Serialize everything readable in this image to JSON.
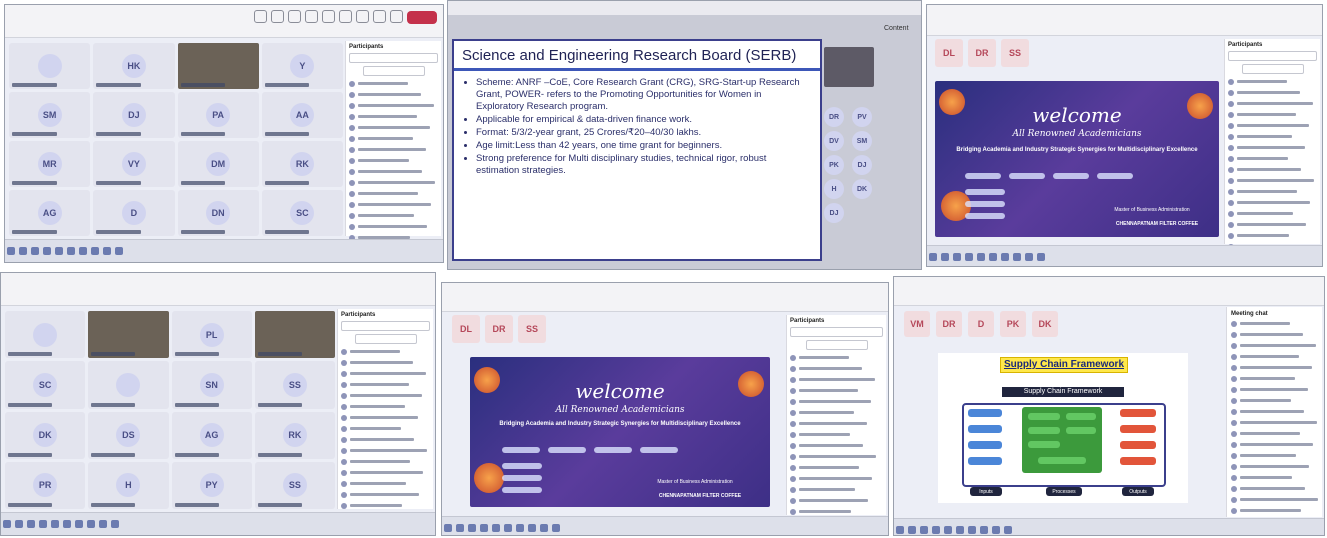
{
  "slide": {
    "title": "Science and Engineering Research Board (SERB)",
    "bullets": [
      "Scheme: ANRF –CoE, Core Research Grant (CRG), SRG-Start-up Research Grant, POWER- refers to the Promoting Opportunities for Women in Exploratory Research program.",
      "Applicable for empirical & data-driven finance work.",
      "Format: 5/3/2-year grant, 25 Crores/₹20–40/30 lakhs.",
      "Age limit:Less than 42 years, one time grant for beginners.",
      "Strong preference for Multi disciplinary studies, technical rigor, robust estimation strategies."
    ]
  },
  "panel1": {
    "participants_title": "Participants",
    "tiles": [
      {
        "initials": "",
        "video": false
      },
      {
        "initials": "HK",
        "video": false
      },
      {
        "initials": "",
        "video": true
      },
      {
        "initials": "Y",
        "video": false
      },
      {
        "initials": "SM",
        "video": false
      },
      {
        "initials": "DJ",
        "video": false
      },
      {
        "initials": "PA",
        "video": false
      },
      {
        "initials": "AA",
        "video": false
      },
      {
        "initials": "MR",
        "video": false
      },
      {
        "initials": "VY",
        "video": false
      },
      {
        "initials": "DM",
        "video": false
      },
      {
        "initials": "RK",
        "video": false
      },
      {
        "initials": "AG",
        "video": false
      },
      {
        "initials": "D",
        "video": false
      },
      {
        "initials": "DN",
        "video": false
      },
      {
        "initials": "SC",
        "video": false
      }
    ]
  },
  "panel2": {
    "side_avatars": [
      "DR",
      "PV",
      "DV",
      "SM",
      "PK",
      "DJ",
      "H",
      "DK",
      "DJ"
    ],
    "side_title": "Content"
  },
  "panel3": {
    "participants_title": "Participants",
    "top_avatars": [
      "DL",
      "DR",
      "SS"
    ],
    "welcome": "welcome",
    "subtitle": "All Renowned Academicians",
    "headline": "Bridging Academia and Industry Strategic Synergies for Multidisciplinary Excellence",
    "org": "Master of Business Administration",
    "sponsor": "CHENNAPATNAM FILTER COFFEE"
  },
  "panel4": {
    "participants_title": "Participants",
    "tiles": [
      {
        "initials": "",
        "video": false
      },
      {
        "initials": "",
        "video": true
      },
      {
        "initials": "PL",
        "video": false
      },
      {
        "initials": "",
        "video": true
      },
      {
        "initials": "SC",
        "video": false
      },
      {
        "initials": "",
        "video": false
      },
      {
        "initials": "SN",
        "video": false
      },
      {
        "initials": "SS",
        "video": false
      },
      {
        "initials": "DK",
        "video": false
      },
      {
        "initials": "DS",
        "video": false
      },
      {
        "initials": "AG",
        "video": false
      },
      {
        "initials": "RK",
        "video": false
      },
      {
        "initials": "PR",
        "video": false
      },
      {
        "initials": "H",
        "video": false
      },
      {
        "initials": "PY",
        "video": false
      },
      {
        "initials": "SS",
        "video": false
      }
    ]
  },
  "panel5": {
    "participants_title": "Participants",
    "top_avatars": [
      "DL",
      "DR",
      "SS"
    ],
    "welcome": "welcome",
    "subtitle": "All Renowned Academicians",
    "headline": "Bridging Academia and Industry Strategic Synergies for Multidisciplinary Excellence",
    "org": "Master of Business Administration",
    "sponsor": "CHENNAPATNAM FILTER COFFEE"
  },
  "panel6": {
    "top_avatars": [
      "VM",
      "DR",
      "D",
      "PK",
      "DK"
    ],
    "chat_title": "Meeting chat",
    "slide_title": "Supply Chain Framework",
    "diagram_title": "Supply Chain Framework",
    "footer_labels": [
      "Inputs",
      "Processes",
      "Outputs"
    ]
  }
}
